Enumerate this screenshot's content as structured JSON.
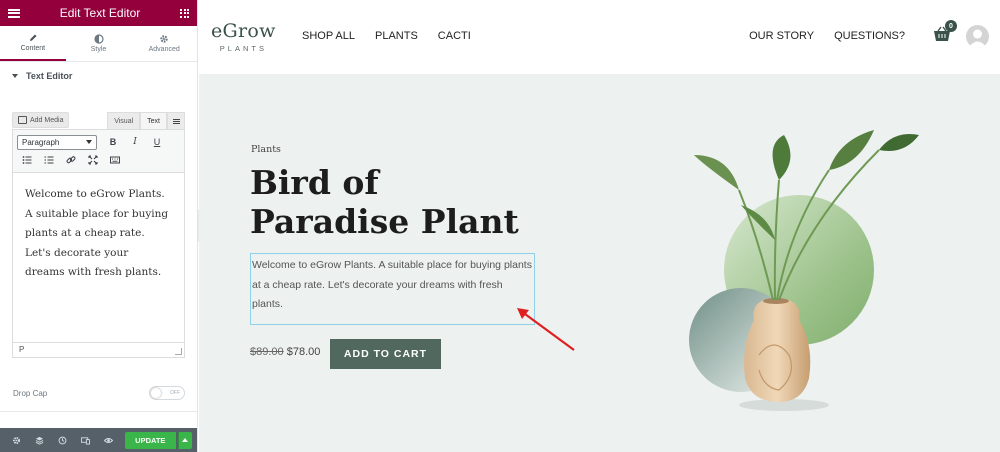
{
  "panel": {
    "title": "Edit Text Editor",
    "tabs": [
      {
        "label": "Content",
        "icon": "pencil-icon"
      },
      {
        "label": "Style",
        "icon": "contrast-icon"
      },
      {
        "label": "Advanced",
        "icon": "gear-icon"
      }
    ],
    "section_title": "Text Editor",
    "add_media_label": "Add Media",
    "mode_tabs": [
      "Visual",
      "Text"
    ],
    "format_select": "Paragraph",
    "toolbar_buttons": [
      "B",
      "I",
      "U"
    ],
    "editor_text": "Welcome to eGrow Plants. A suitable place for buying plants at a cheap rate. Let's decorate your dreams with fresh plants.",
    "editor_status": "P",
    "drop_cap_label": "Drop Cap",
    "drop_cap_switch": "OFF",
    "update_label": "UPDATE",
    "accent_color": "#93003c",
    "update_color": "#39b54a"
  },
  "site": {
    "logo_main": "eGrow",
    "logo_sub": "PLANTS",
    "nav_left": [
      "SHOP ALL",
      "PLANTS",
      "CACTI"
    ],
    "nav_right": [
      "OUR STORY",
      "QUESTIONS?"
    ],
    "cart_count": "0",
    "category": "Plants",
    "title": "Bird of Paradise Plant",
    "description": "Welcome to eGrow Plants. A suitable place for buying plants at a cheap rate. Let's decorate your dreams with fresh plants.",
    "old_price": "$89.00",
    "new_price": "$78.00",
    "add_to_cart_label": "ADD TO CART",
    "brand_color": "#51685e"
  }
}
